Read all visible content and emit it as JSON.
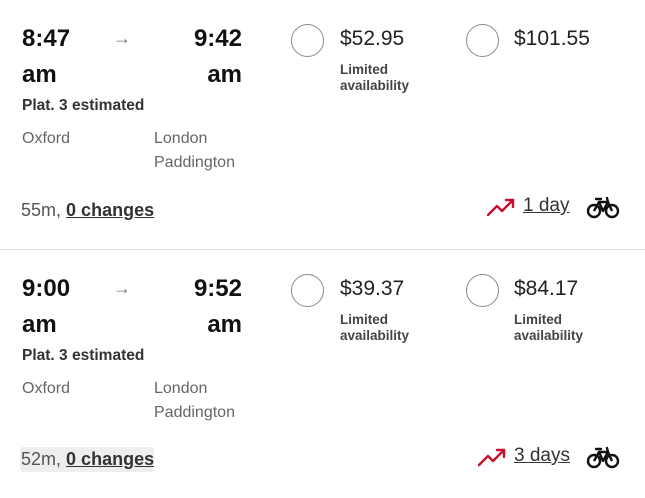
{
  "journeys": [
    {
      "departure": {
        "hour": "8:47",
        "ampm": "am"
      },
      "arrival": {
        "hour": "9:42",
        "ampm": "am"
      },
      "arrow": "→",
      "platform": "Plat. 3 estimated",
      "origin": "Oxford",
      "destination_line1": "London",
      "destination_line2": "Paddington",
      "fares": [
        {
          "price": "$52.95",
          "availability_line1": "Limited",
          "availability_line2": "availability"
        },
        {
          "price": "$101.55",
          "availability_line1": "",
          "availability_line2": ""
        }
      ],
      "duration": "55m,",
      "changes": "0 changes",
      "trend_link": "1 day",
      "trend_color": "#c8102e"
    },
    {
      "departure": {
        "hour": "9:00",
        "ampm": "am"
      },
      "arrival": {
        "hour": "9:52",
        "ampm": "am"
      },
      "arrow": "→",
      "platform": "Plat. 3 estimated",
      "origin": "Oxford",
      "destination_line1": "London",
      "destination_line2": "Paddington",
      "fares": [
        {
          "price": "$39.37",
          "availability_line1": "Limited",
          "availability_line2": "availability"
        },
        {
          "price": "$84.17",
          "availability_line1": "Limited",
          "availability_line2": "availability"
        }
      ],
      "duration": "52m,",
      "changes": "0 changes",
      "trend_link": "3 days",
      "trend_color": "#c8102e"
    }
  ],
  "icons": {
    "trend": "trending-up-icon",
    "bike": "bicycle-icon",
    "arrow": "arrow-right-icon"
  }
}
